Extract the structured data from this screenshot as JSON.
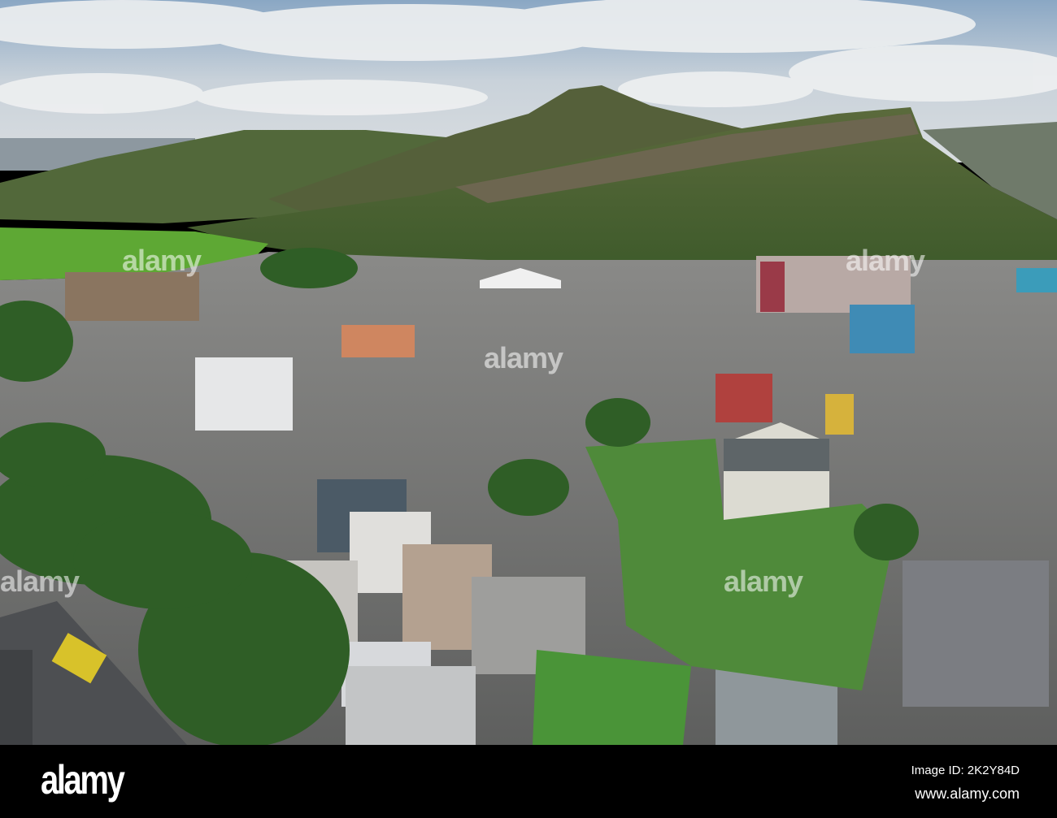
{
  "photo": {
    "subject": "aerial-cityscape-with-hills"
  },
  "watermark": {
    "text": "alamy"
  },
  "footer": {
    "logo": "alamy",
    "image_id": "Image ID: 2K2Y84D",
    "website": "www.alamy.com"
  }
}
